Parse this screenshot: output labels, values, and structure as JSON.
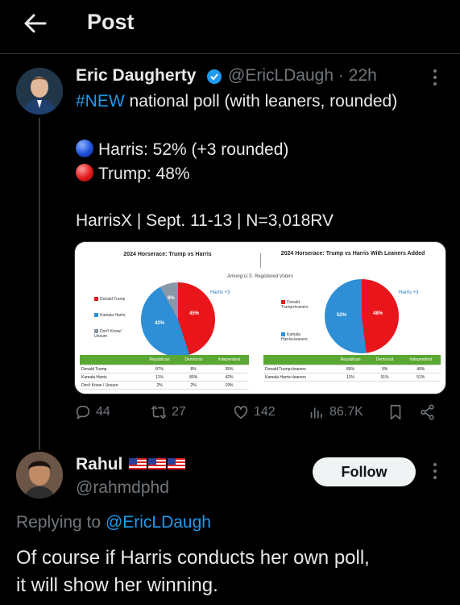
{
  "header": {
    "title": "Post"
  },
  "tweet": {
    "author_name": "Eric Daugherty",
    "handle_time": "@EricLDaugh · 22h",
    "line1_hashtag": "#NEW",
    "line1_rest": " national poll (with leaners, rounded)",
    "harris_line": "Harris: 52% (+3 rounded)",
    "trump_line": "Trump: 48%",
    "source_line": "HarrisX | Sept. 11-13 | N=3,018RV",
    "colors": {
      "blue_ball": "#1d4fd8",
      "red_ball": "#e01919",
      "verified": "#1d9bf0"
    }
  },
  "poll_image": {
    "left_title": "2024 Horserace: Trump vs Harris",
    "right_title": "2024 Horserace: Trump vs Harris With Leaners Added",
    "subtitle": "Among U.S. Registered Voters",
    "left": {
      "harris_tag": "Harris +3",
      "slices": {
        "trump": "45%",
        "harris": "42%",
        "unsure": "8%"
      },
      "legend": [
        "Donald Trump",
        "Kamala Harris",
        "Don't Know/ Unsure"
      ],
      "table_header": [
        "",
        "Republican",
        "Democrat",
        "Independent"
      ],
      "rows": [
        [
          "Donald Trump",
          "87%",
          "8%",
          "35%"
        ],
        [
          "Kamala Harris",
          "11%",
          "89%",
          "42%"
        ],
        [
          "Don't Know / Unsure",
          "2%",
          "2%",
          "19%"
        ]
      ]
    },
    "right": {
      "harris_tag": "Harris +3",
      "slices": {
        "harris": "52%",
        "trump": "48%"
      },
      "legend": [
        "Donald Trump+leaners",
        "Kamala Harris+leaners"
      ],
      "table_header": [
        "",
        "Republican",
        "Democrat",
        "Independent"
      ],
      "rows": [
        [
          "Donald Trump+leaners",
          "89%",
          "9%",
          "49%"
        ],
        [
          "Kamala Harris+leaners",
          "11%",
          "91%",
          "51%"
        ]
      ]
    }
  },
  "actions": {
    "replies": "44",
    "reposts": "27",
    "likes": "142",
    "views": "86.7K"
  },
  "reply": {
    "author_name": "Rahul",
    "handle": "@rahmdphd",
    "follow_label": "Follow",
    "replying_prefix": "Replying to ",
    "replying_mention": "@EricLDaugh",
    "text_line1": "Of course if Harris conducts her own poll,",
    "text_line2": "it will show her winning."
  }
}
